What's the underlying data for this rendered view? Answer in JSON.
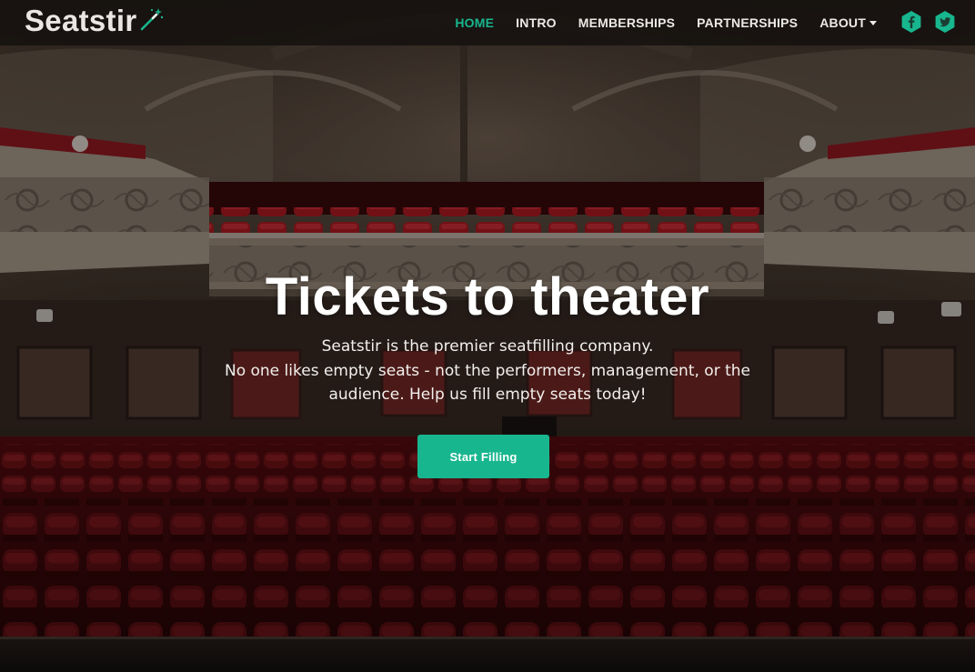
{
  "brand": {
    "name": "Seatstir",
    "icon": "magic-wand-icon"
  },
  "nav": {
    "items": [
      {
        "label": "HOME",
        "active": true
      },
      {
        "label": "INTRO",
        "active": false
      },
      {
        "label": "MEMBERSHIPS",
        "active": false
      },
      {
        "label": "PARTNERSHIPS",
        "active": false
      },
      {
        "label": "ABOUT",
        "active": false,
        "dropdown": true
      }
    ],
    "social": [
      {
        "icon": "facebook-icon",
        "glyph": "f"
      },
      {
        "icon": "twitter-icon",
        "glyph": "twitter-bird"
      }
    ]
  },
  "hero": {
    "title": "Tickets to theater",
    "subtitle_lines": [
      "Seatstir is the premier seatfilling company.",
      "No one likes empty seats - not the performers, management, or the",
      "audience. Help us fill empty seats today!"
    ],
    "cta_label": "Start Filling",
    "background": "theater-auditorium-photo"
  },
  "colors": {
    "accent": "#18b68e",
    "nav_bg": "#14100e",
    "text": "#ffffff"
  }
}
